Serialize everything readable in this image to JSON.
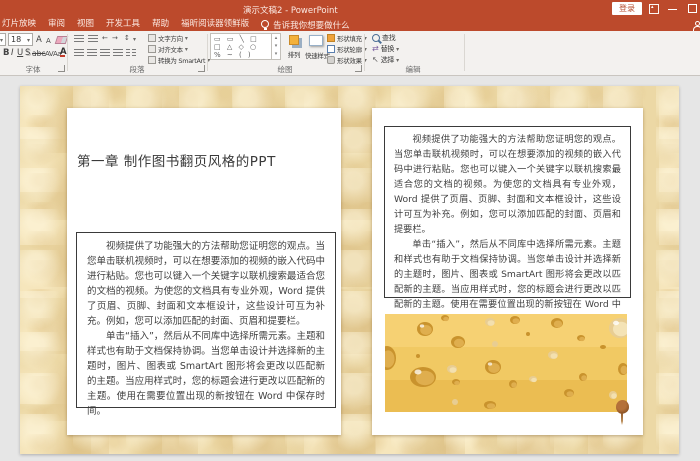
{
  "window": {
    "title": "演示文稿2 - PowerPoint",
    "login": "登录"
  },
  "menubar": {
    "tabs": [
      "灯片放映",
      "审阅",
      "视图",
      "开发工具",
      "帮助",
      "福昕阅读器领鲜版"
    ],
    "tell_me": "告诉我你想要做什么"
  },
  "ribbon": {
    "font": {
      "label": "字体",
      "size_value": "18",
      "grow": "A",
      "shrink": "A",
      "bold": "B",
      "italic": "I",
      "underline": "U",
      "shadow": "S",
      "strike": "abc",
      "char_spacing": "AV",
      "change_case": "Aa",
      "font_color": "A"
    },
    "paragraph": {
      "label": "段落",
      "text_direction": "文字方向",
      "align_text": "对齐文本",
      "to_smartart": "转换为 SmartArt"
    },
    "drawing": {
      "label": "绘图",
      "gallery_rows": [
        "▭ ▭ ╲ □",
        "□ △ ◇ ○",
        "% ~ ( )"
      ],
      "arrange": "排列",
      "quick_styles": "快速样式",
      "shape_fill": "形状填充",
      "shape_outline": "形状轮廓",
      "shape_effects": "形状效果"
    },
    "editing": {
      "label": "编辑",
      "find": "查找",
      "replace": "替换",
      "select": "选择"
    }
  },
  "slide": {
    "chapter_title": "第一章 制作图书翻页风格的PPT",
    "paragraph1": "视频提供了功能强大的方法帮助您证明您的观点。当您单击联机视频时，可以在想要添加的视频的嵌入代码中进行粘贴。您也可以键入一个关键字以联机搜索最适合您的文档的视频。为使您的文档具有专业外观，Word 提供了页眉、页脚、封面和文本框设计，这些设计可互为补充。例如，您可以添加匹配的封面、页眉和提要栏。",
    "paragraph2": "单击“插入”，然后从不同库中选择所需元素。主题和样式也有助于文档保持协调。当您单击设计并选择新的主题时，图片、图表或 SmartArt 图形将会更改以匹配新的主题。当应用样式时，您的标题会进行更改以匹配新的主题。使用在需要位置出现的新按钮在 Word 中保存时间。"
  },
  "colors": {
    "titlebar": "#BC4A2C",
    "ribbon_bg": "#F3F1EF",
    "canvas_bg": "#E6E6E6",
    "parchment": "#ECD8A5",
    "cheese_base": "#F2C963",
    "accent_red": "#C33B29"
  }
}
